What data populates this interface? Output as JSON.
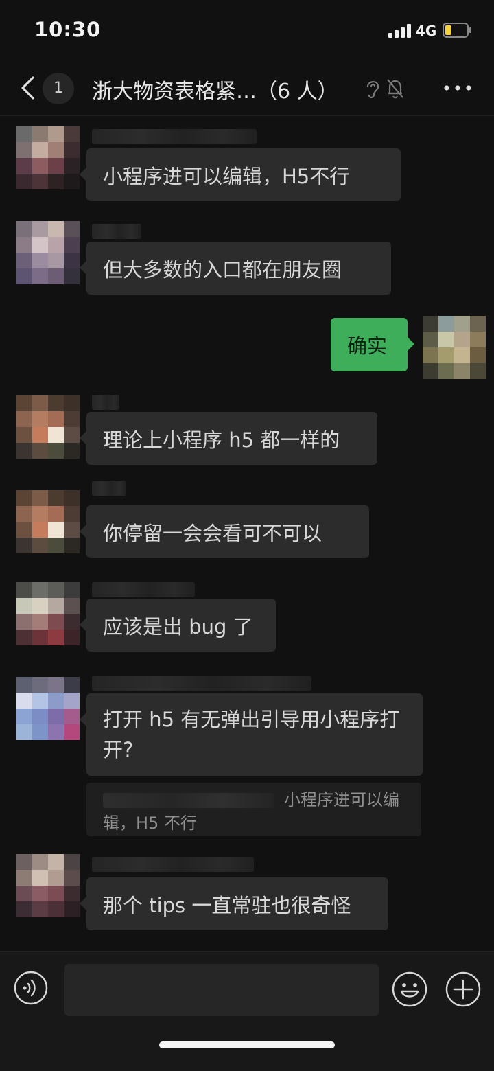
{
  "status_bar": {
    "time": "10:30",
    "network": "4G",
    "battery_level": 0.3
  },
  "header": {
    "unread_count": "1",
    "title": "浙大物资表格紧…（6 人）"
  },
  "messages": [
    {
      "side": "left",
      "text": "小程序进可以编辑，H5不行"
    },
    {
      "side": "left",
      "text": "但大多数的入口都在朋友圈"
    },
    {
      "side": "right",
      "text": "确实"
    },
    {
      "side": "left",
      "text": "理论上小程序 h5 都一样的"
    },
    {
      "side": "left",
      "text": "你停留一会会看可不可以"
    },
    {
      "side": "left",
      "text": "应该是出 bug 了"
    },
    {
      "side": "left",
      "text": "打开 h5 有无弹出引导用小程序打开?",
      "quote": "小程序进可以编辑，H5 不行"
    },
    {
      "side": "left",
      "text": "那个 tips 一直常驻也很奇怪"
    }
  ],
  "input_bar": {
    "text_value": ""
  },
  "colors": {
    "background": "#111111",
    "bubble_incoming": "#2c2c2c",
    "bubble_outgoing": "#3fae5b",
    "text_primary": "#d8d8d8"
  },
  "icons": [
    "back-chevron-icon",
    "ear-icon",
    "mute-bell-icon",
    "more-dots-icon",
    "voice-icon",
    "emoji-icon",
    "plus-icon"
  ]
}
